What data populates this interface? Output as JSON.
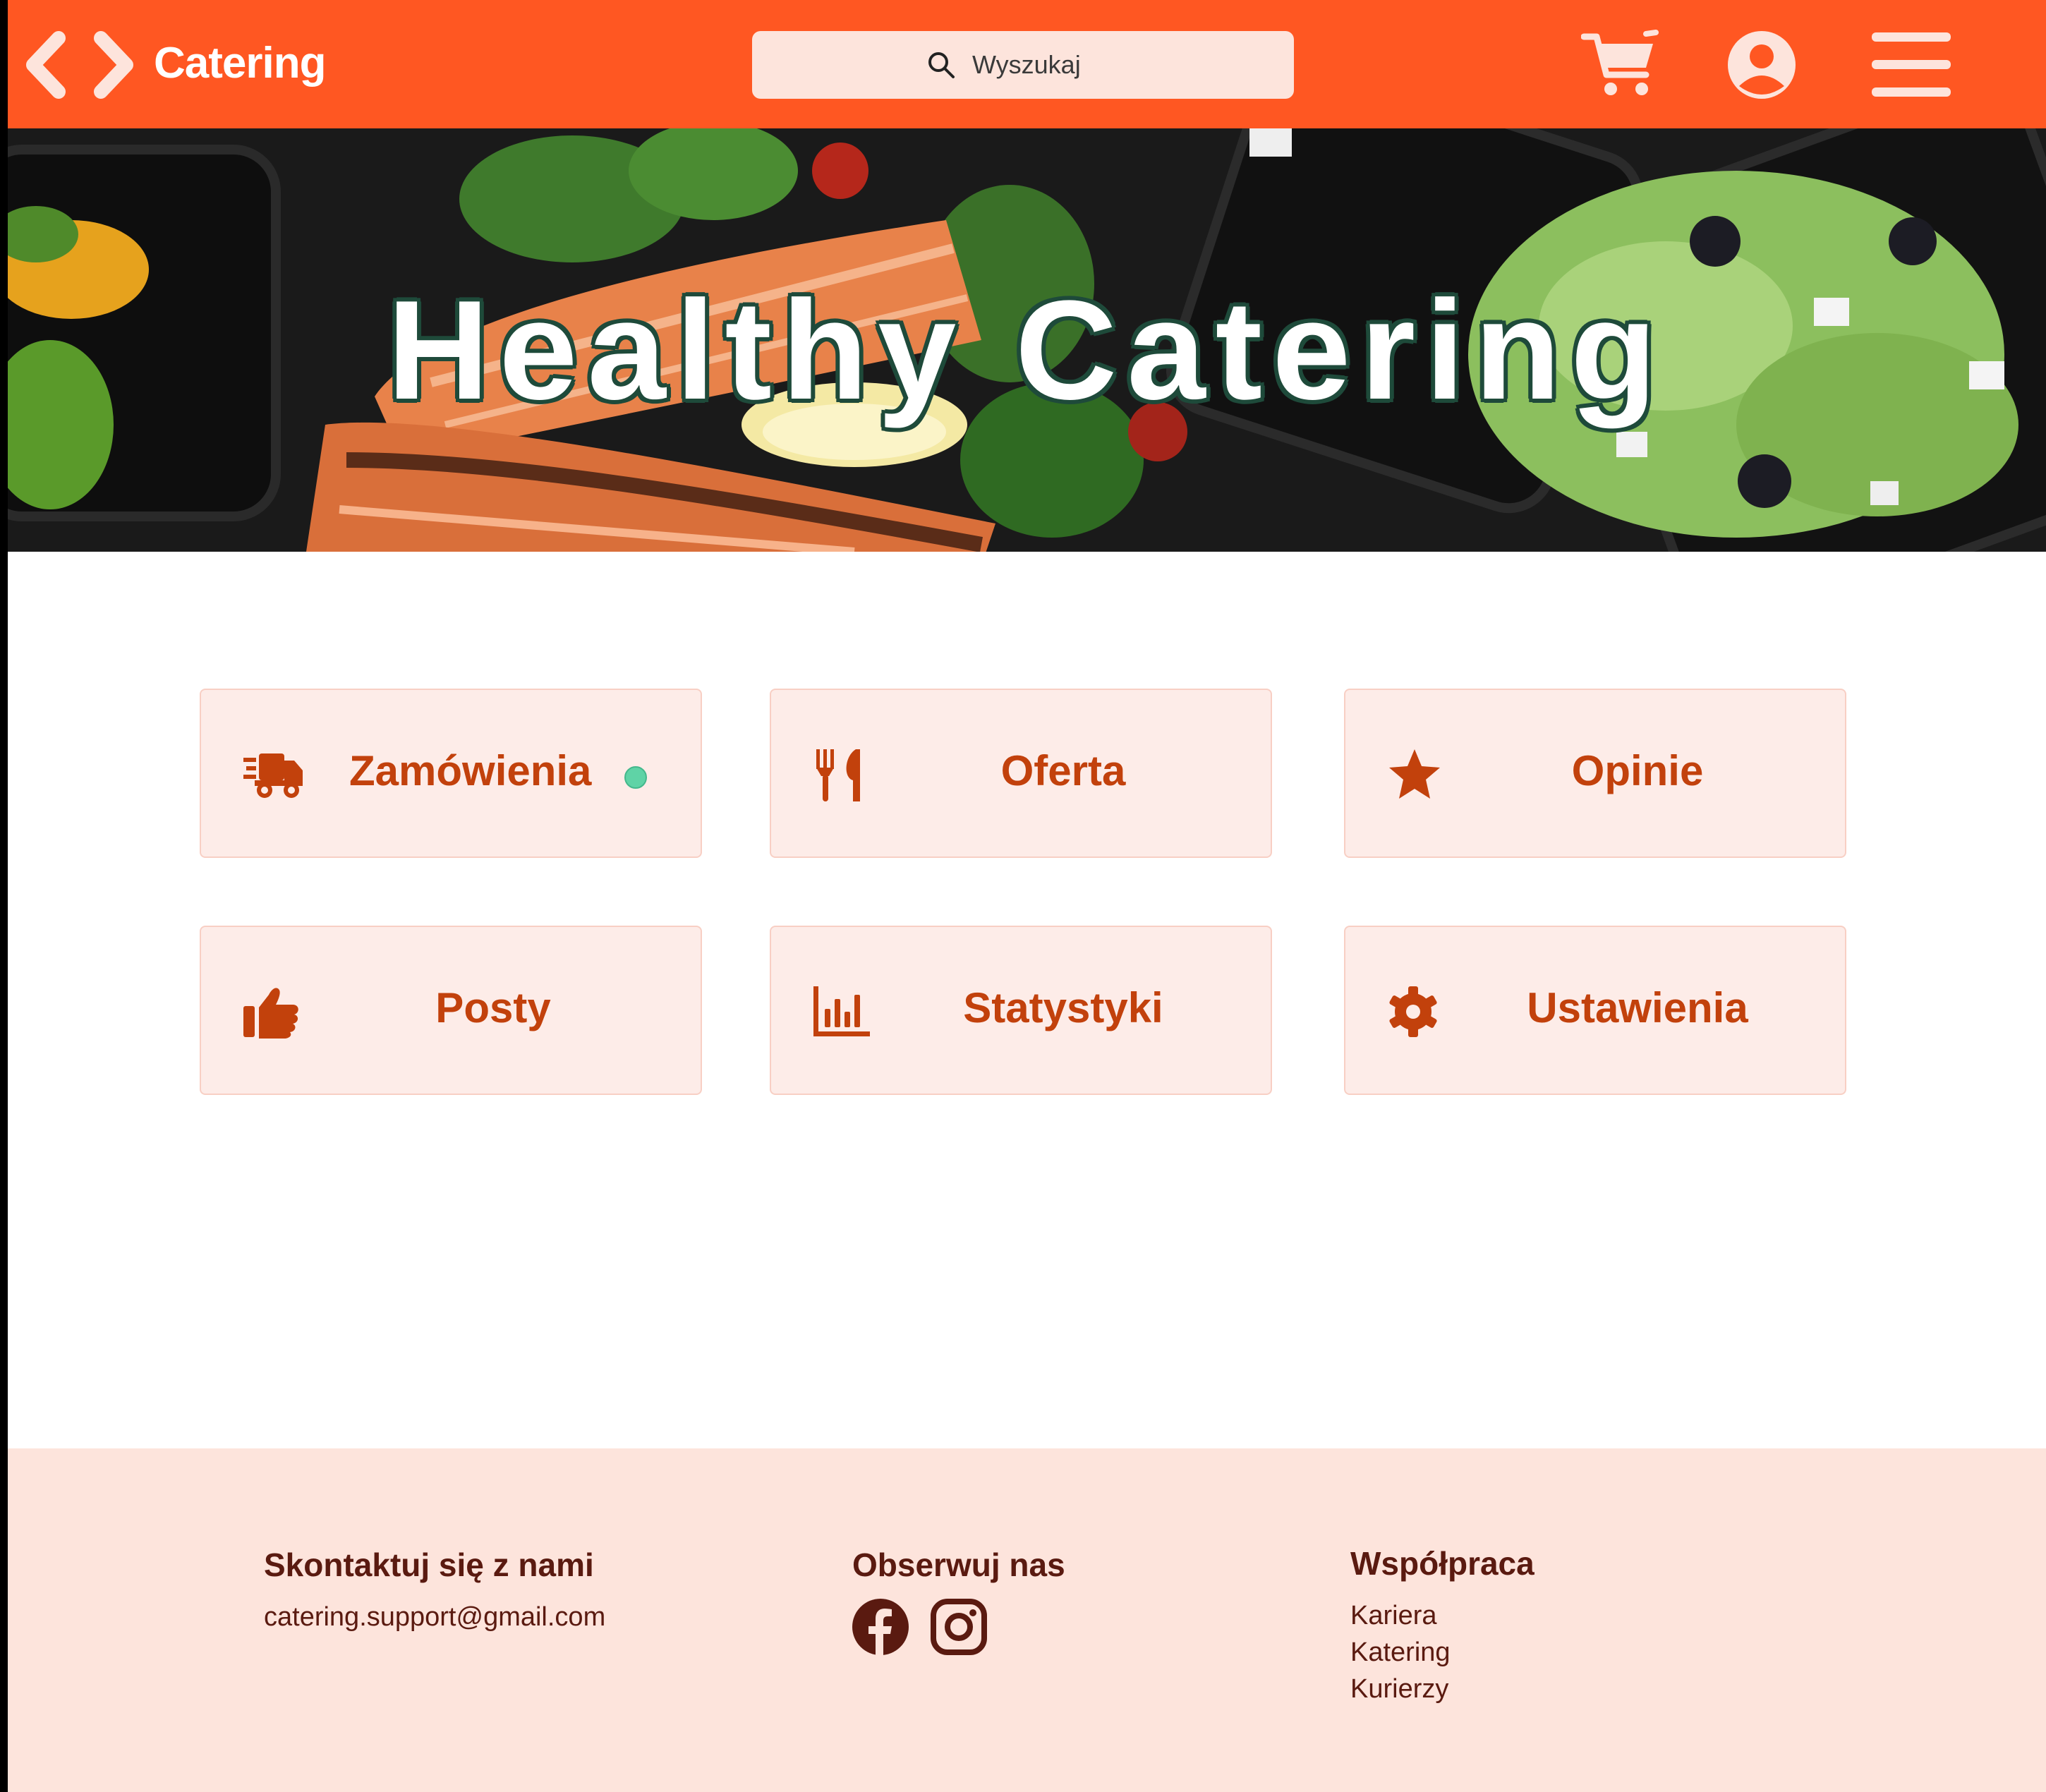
{
  "header": {
    "brand": "Catering",
    "search_placeholder": "Wyszukaj",
    "icons": [
      "back-arrow-icon",
      "forward-arrow-icon",
      "search-icon",
      "cart-icon",
      "user-icon",
      "hamburger-menu-icon"
    ],
    "color": "#ff5722"
  },
  "hero": {
    "title": "Healthy Catering"
  },
  "menu": {
    "cards": [
      {
        "label": "Zamówienia",
        "icon": "delivery-truck-icon",
        "has_status_dot": true
      },
      {
        "label": "Oferta",
        "icon": "utensils-icon"
      },
      {
        "label": "Opinie",
        "icon": "star-icon"
      },
      {
        "label": "Posty",
        "icon": "thumbs-up-icon"
      },
      {
        "label": "Statystyki",
        "icon": "bar-chart-icon"
      },
      {
        "label": "Ustawienia",
        "icon": "gear-icon"
      }
    ],
    "accent": "#c2410c",
    "status_dot_color": "#5fd3a6"
  },
  "footer": {
    "contact": {
      "title": "Skontaktuj się z nami",
      "email": "catering.support@gmail.com"
    },
    "follow": {
      "title": "Obserwuj nas",
      "icons": [
        "facebook-icon",
        "instagram-icon"
      ]
    },
    "cooperation": {
      "title": "Współpraca",
      "links": [
        "Kariera",
        "Katering",
        "Kurierzy"
      ]
    },
    "color": "#5a1a10"
  }
}
